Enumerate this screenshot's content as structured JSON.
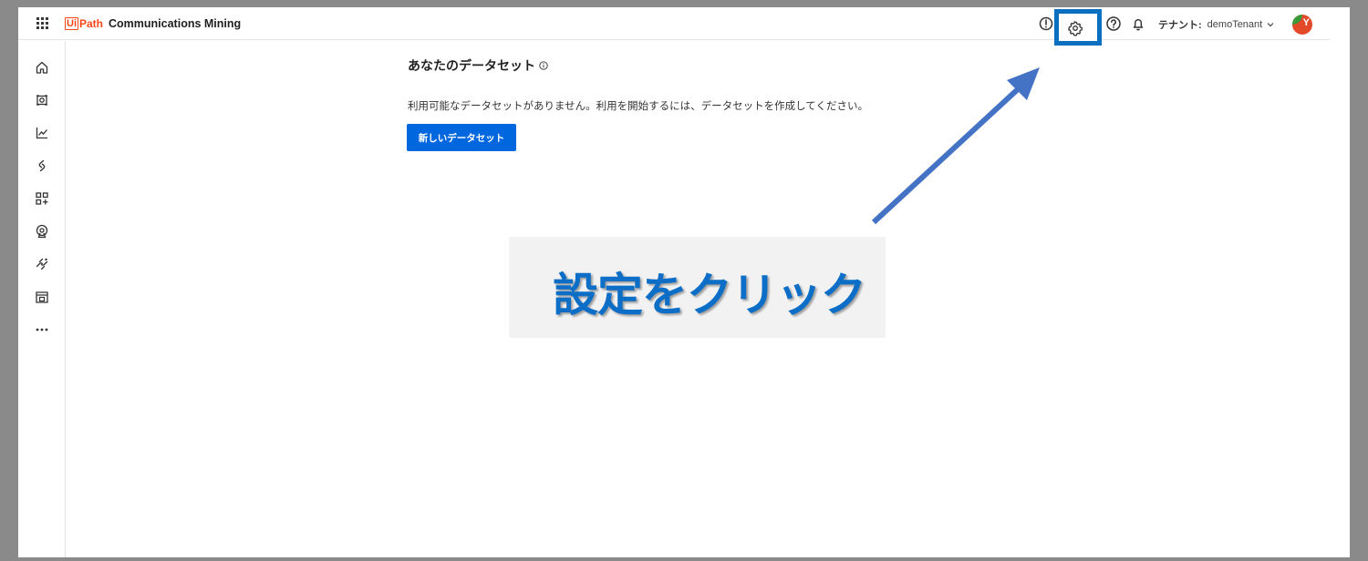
{
  "header": {
    "logo_ui": "Ui",
    "logo_path": "Path",
    "product_name": "Communications Mining",
    "tenant_label": "テナント:",
    "tenant_name": "demoTenant",
    "avatar_initial": "Y"
  },
  "sidebar": {
    "items": [
      {
        "icon": "home-icon"
      },
      {
        "icon": "explore-icon"
      },
      {
        "icon": "analytics-icon"
      },
      {
        "icon": "integrations-icon"
      },
      {
        "icon": "add-widget-icon"
      },
      {
        "icon": "sources-icon"
      },
      {
        "icon": "streams-icon"
      },
      {
        "icon": "dataset-icon"
      },
      {
        "icon": "more-icon"
      }
    ]
  },
  "main": {
    "title": "あなたのデータセット",
    "empty_message": "利用可能なデータセットがありません。利用を開始するには、データセットを作成してください。",
    "new_button_label": "新しいデータセット"
  },
  "annotation": {
    "callout_text": "設定をクリック",
    "highlight_color": "#0b6fbf",
    "arrow_color": "#4472c4"
  }
}
